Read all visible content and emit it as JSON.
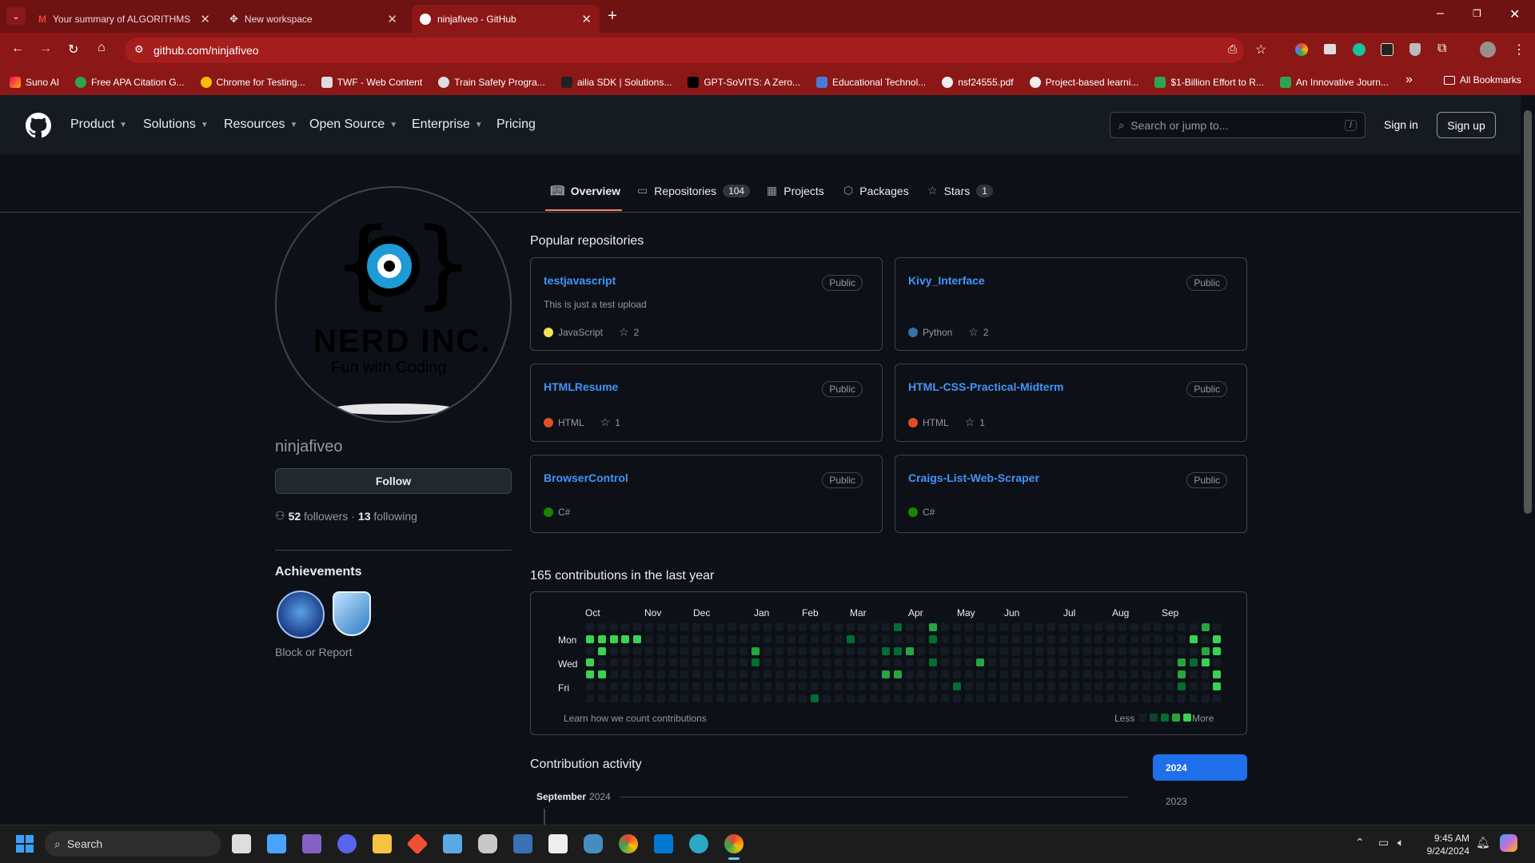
{
  "browser": {
    "tabs": [
      {
        "title": "Your summary of ALGORITHMS",
        "icon": "gmail-icon"
      },
      {
        "title": "New workspace",
        "icon": "workspace-icon"
      },
      {
        "title": "ninjafiveo - GitHub",
        "icon": "github-icon"
      }
    ],
    "url": "github.com/ninjafiveo",
    "bookmarks": [
      "Suno AI",
      "Free APA Citation G...",
      "Chrome for Testing...",
      "TWF - Web Content",
      "Train Safety Progra...",
      "ailia SDK | Solutions...",
      "GPT-SoVITS: A Zero...",
      "Educational Technol...",
      "nsf24555.pdf",
      "Project-based learni...",
      "$1-Billion Effort to R...",
      "An Innovative Journ..."
    ],
    "all_bookmarks": "All Bookmarks",
    "more_bookmarks": "»",
    "colors": {
      "tabbar": "#6e1212",
      "toolbar": "#8b1717"
    }
  },
  "header": {
    "nav": [
      "Product",
      "Solutions",
      "Resources",
      "Open Source",
      "Enterprise",
      "Pricing"
    ],
    "search_placeholder": "Search or jump to...",
    "search_shortcut": "/",
    "sign_in": "Sign in",
    "sign_up": "Sign up"
  },
  "profile_tabs": [
    {
      "label": "Overview",
      "count": ""
    },
    {
      "label": "Repositories",
      "count": "104"
    },
    {
      "label": "Projects",
      "count": ""
    },
    {
      "label": "Packages",
      "count": ""
    },
    {
      "label": "Stars",
      "count": "1"
    }
  ],
  "profile": {
    "avatar_logo_text": "NERD INC.",
    "avatar_tagline": "Fun with Coding",
    "username": "ninjafiveo",
    "follow_label": "Follow",
    "followers_count": "52",
    "followers_label": "followers",
    "separator": "·",
    "following_count": "13",
    "following_label": "following",
    "achievements_title": "Achievements",
    "block_report": "Block or Report"
  },
  "popular": {
    "title": "Popular repositories",
    "repos": [
      {
        "name": "testjavascript",
        "visibility": "Public",
        "description": "This is just a test upload",
        "language": "JavaScript",
        "lang_color": "#f1e05a",
        "stars": "2"
      },
      {
        "name": "Kivy_Interface",
        "visibility": "Public",
        "description": "",
        "language": "Python",
        "lang_color": "#3572A5",
        "stars": "2"
      },
      {
        "name": "HTMLResume",
        "visibility": "Public",
        "description": "",
        "language": "HTML",
        "lang_color": "#e34c26",
        "stars": "1"
      },
      {
        "name": "HTML-CSS-Practical-Midterm",
        "visibility": "Public",
        "description": "",
        "language": "HTML",
        "lang_color": "#e34c26",
        "stars": "1"
      },
      {
        "name": "BrowserControl",
        "visibility": "Public",
        "description": "",
        "language": "C#",
        "lang_color": "#178600",
        "stars": ""
      },
      {
        "name": "Craigs-List-Web-Scraper",
        "visibility": "Public",
        "description": "",
        "language": "C#",
        "lang_color": "#178600",
        "stars": ""
      }
    ]
  },
  "contributions": {
    "title": "165 contributions in the last year",
    "months": [
      "Oct",
      "Nov",
      "Dec",
      "Jan",
      "Feb",
      "Mar",
      "Apr",
      "May",
      "Jun",
      "Jul",
      "Aug",
      "Sep"
    ],
    "days": [
      "Mon",
      "Wed",
      "Fri"
    ],
    "learn": "Learn how we count contributions",
    "less": "Less",
    "more": "More",
    "levels": [
      "#0e4429",
      "#006d32",
      "#26a641",
      "#39d353"
    ],
    "active_cells": [
      {
        "week": 0,
        "day": 1,
        "level": 3
      },
      {
        "week": 0,
        "day": 3,
        "level": 3
      },
      {
        "week": 0,
        "day": 4,
        "level": 3
      },
      {
        "week": 1,
        "day": 1,
        "level": 3
      },
      {
        "week": 1,
        "day": 2,
        "level": 3
      },
      {
        "week": 1,
        "day": 4,
        "level": 3
      },
      {
        "week": 2,
        "day": 1,
        "level": 3
      },
      {
        "week": 3,
        "day": 1,
        "level": 3
      },
      {
        "week": 4,
        "day": 1,
        "level": 3
      },
      {
        "week": 14,
        "day": 2,
        "level": 2
      },
      {
        "week": 14,
        "day": 3,
        "level": 1
      },
      {
        "week": 19,
        "day": 6,
        "level": 1
      },
      {
        "week": 22,
        "day": 1,
        "level": 1
      },
      {
        "week": 25,
        "day": 4,
        "level": 2
      },
      {
        "week": 25,
        "day": 2,
        "level": 1
      },
      {
        "week": 26,
        "day": 0,
        "level": 1
      },
      {
        "week": 26,
        "day": 2,
        "level": 1
      },
      {
        "week": 26,
        "day": 4,
        "level": 2
      },
      {
        "week": 27,
        "day": 2,
        "level": 2
      },
      {
        "week": 29,
        "day": 0,
        "level": 2
      },
      {
        "week": 29,
        "day": 1,
        "level": 1
      },
      {
        "week": 29,
        "day": 3,
        "level": 1
      },
      {
        "week": 33,
        "day": 3,
        "level": 2
      },
      {
        "week": 31,
        "day": 5,
        "level": 1
      },
      {
        "week": 50,
        "day": 3,
        "level": 2
      },
      {
        "week": 50,
        "day": 4,
        "level": 2
      },
      {
        "week": 50,
        "day": 5,
        "level": 1
      },
      {
        "week": 51,
        "day": 1,
        "level": 3
      },
      {
        "week": 51,
        "day": 3,
        "level": 1
      },
      {
        "week": 52,
        "day": 0,
        "level": 2
      },
      {
        "week": 52,
        "day": 2,
        "level": 2
      },
      {
        "week": 52,
        "day": 3,
        "level": 3
      },
      {
        "week": 53,
        "day": 1,
        "level": 3
      },
      {
        "week": 53,
        "day": 2,
        "level": 3
      },
      {
        "week": 53,
        "day": 4,
        "level": 3
      },
      {
        "week": 53,
        "day": 5,
        "level": 3
      },
      {
        "week": 54,
        "day": 1,
        "level": 2
      },
      {
        "week": 54,
        "day": 2,
        "level": 3
      },
      {
        "week": 54,
        "day": 3,
        "level": 3
      }
    ]
  },
  "activity": {
    "title": "Contribution activity",
    "month": "September",
    "year": "2024",
    "years": [
      "2024",
      "2023"
    ]
  },
  "taskbar": {
    "search": "Search",
    "time": "9:45 AM",
    "date": "9/24/2024"
  }
}
